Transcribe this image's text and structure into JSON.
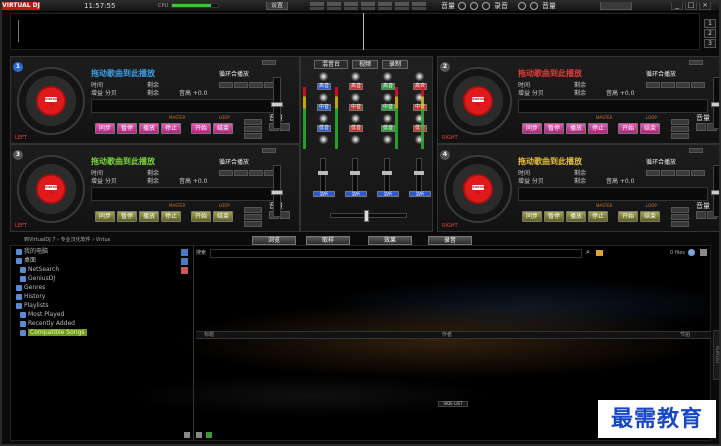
{
  "app": {
    "logo": "VIRTUAL DJ",
    "clock": "11:57:55",
    "cpu_label": "CPU",
    "cpu_level": 0.85
  },
  "toolbar": {
    "config_button": "设置",
    "gain_label": "音量",
    "record_label": "录音",
    "volume_label": "音量"
  },
  "window": {
    "minimize": "_",
    "maximize": "□",
    "close": "×"
  },
  "sidebuttons": [
    "1",
    "2",
    "3"
  ],
  "decks": [
    {
      "number": "1",
      "side": "LEFT",
      "title": "拖动歌曲到此播放",
      "title_color": "#3aa0e8",
      "time_label": "时间",
      "remain_label": "剩余",
      "gain_label": "增益 分贝",
      "key_label": "音高 +0.0",
      "cue_play": "循环合播放",
      "master": "MASTER",
      "loop": "LOOP",
      "buttons": [
        "同步",
        "暂停",
        "播放",
        "停止"
      ],
      "extra_buttons": [
        "开始",
        "结束"
      ],
      "vol": "音量",
      "theme": "pink",
      "pitch": 0.5
    },
    {
      "number": "2",
      "side": "RIGHT",
      "title": "拖动歌曲到此播放",
      "title_color": "#e43a3a",
      "time_label": "时间",
      "remain_label": "剩余",
      "gain_label": "增益 分贝",
      "key_label": "音高 +0.0",
      "cue_play": "循环合播放",
      "master": "MASTER",
      "loop": "LOOP",
      "buttons": [
        "同步",
        "暂停",
        "播放",
        "停止"
      ],
      "extra_buttons": [
        "开始",
        "结束"
      ],
      "vol": "音量",
      "theme": "pink",
      "pitch": 0.5
    },
    {
      "number": "3",
      "side": "LEFT",
      "title": "拖动歌曲到此播放",
      "title_color": "#7cd43a",
      "time_label": "时间",
      "remain_label": "剩余",
      "gain_label": "增益 分贝",
      "key_label": "音高 +0.0",
      "cue_play": "循环合播放",
      "master": "MASTER",
      "loop": "LOOP",
      "buttons": [
        "同步",
        "暂停",
        "播放",
        "停止"
      ],
      "extra_buttons": [
        "开始",
        "结束"
      ],
      "vol": "音量",
      "theme": "olive",
      "pitch": 0.5
    },
    {
      "number": "4",
      "side": "RIGHT",
      "title": "拖动歌曲到此播放",
      "title_color": "#e8c03a",
      "time_label": "时间",
      "remain_label": "剩余",
      "gain_label": "增益 分贝",
      "key_label": "音高 +0.0",
      "cue_play": "循环合播放",
      "master": "MASTER",
      "loop": "LOOP",
      "buttons": [
        "同步",
        "暂停",
        "播放",
        "停止"
      ],
      "extra_buttons": [
        "开始",
        "结束"
      ],
      "vol": "音量",
      "theme": "olive",
      "pitch": 0.5
    }
  ],
  "mixer": {
    "tabs": [
      "混音台",
      "视频",
      "录制"
    ],
    "eq_tags": [
      [
        "高音",
        "中音",
        "低音"
      ],
      [
        "高音",
        "中音",
        "低音"
      ],
      [
        "高音",
        "中音",
        "低音"
      ],
      [
        "高音",
        "中音",
        "低音"
      ]
    ],
    "cue_label": "监听"
  },
  "nav": {
    "tabs": [
      "浏览",
      "取样",
      "效果",
      "录音"
    ]
  },
  "browser": {
    "breadcrumb": "到VirtualDJ 7 › 专业汉化软件 › Virtus",
    "search_label": "搜索",
    "file_count": "0 files",
    "tree": [
      "我的电脑",
      "桌面",
      "NetSearch",
      "GeniusDJ",
      "Genres",
      "History",
      "Playlists",
      "Most Played",
      "Recently Added",
      "Compatible Songs"
    ],
    "columns": [
      "标题",
      "作者",
      "节拍"
    ],
    "side_list": "SIDE LIST",
    "playlist_tab": "PLAYLIST"
  },
  "watermark": "最需教育"
}
